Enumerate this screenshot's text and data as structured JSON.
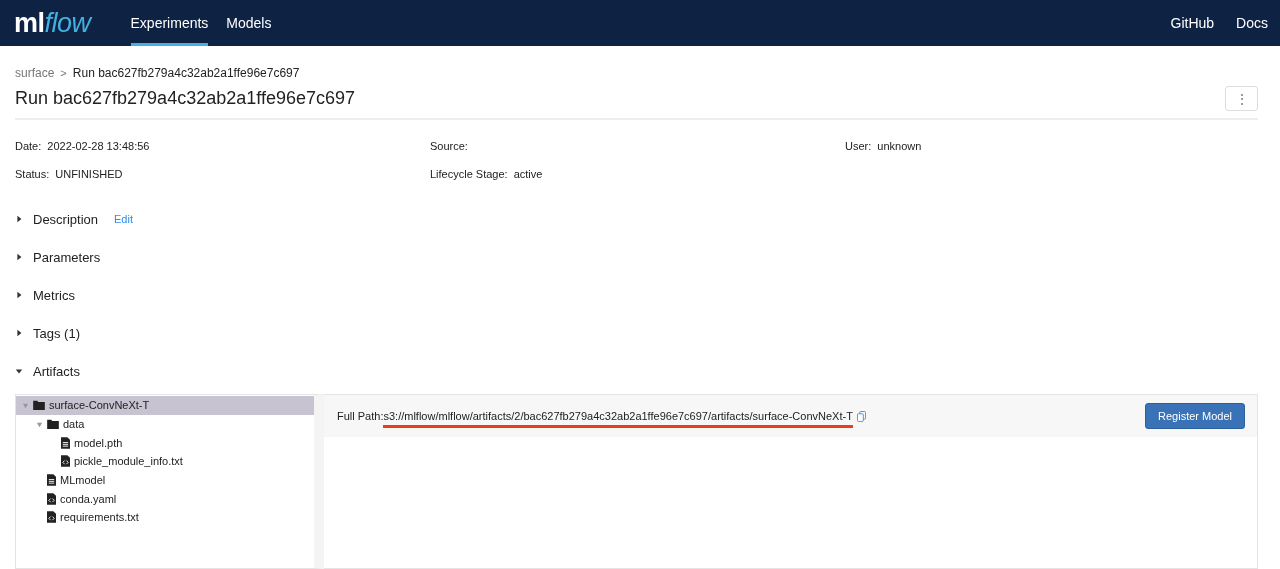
{
  "nav": {
    "logo": {
      "plain": "ml",
      "accent": "flow"
    },
    "tabs": [
      {
        "label": "Experiments",
        "selected": true
      },
      {
        "label": "Models",
        "selected": false
      }
    ],
    "links": [
      "GitHub",
      "Docs"
    ]
  },
  "breadcrumb": {
    "parent": "surface",
    "separator": ">",
    "current": "Run bac627fb279a4c32ab2a1ffe96e7c697"
  },
  "title": "Run bac627fb279a4c32ab2a1ffe96e7c697",
  "menu_button": "⋮",
  "meta": [
    {
      "label": "Date:",
      "value": "2022-02-28 13:48:56"
    },
    {
      "label": "Source:"
    },
    {
      "label": "User:",
      "value": "unknown"
    },
    {
      "label": "Status:",
      "value": "UNFINISHED"
    },
    {
      "label": "Lifecycle Stage:",
      "value": "active"
    }
  ],
  "sections": [
    {
      "label": "Description",
      "expanded": false,
      "action": "Edit"
    },
    {
      "label": "Parameters",
      "expanded": false
    },
    {
      "label": "Metrics",
      "expanded": false
    },
    {
      "label": "Tags (1)",
      "expanded": false
    },
    {
      "label": "Artifacts",
      "expanded": true
    }
  ],
  "artifacts": {
    "tree": [
      {
        "kind": "folder",
        "name": "surface-ConvNeXt-T",
        "expanded": true,
        "selected": true,
        "children": [
          {
            "kind": "folder",
            "name": "data",
            "expanded": true,
            "selected": false,
            "children": [
              {
                "kind": "file",
                "name": "model.pth",
                "selected": false
              },
              {
                "kind": "code",
                "name": "pickle_module_info.txt",
                "selected": false
              }
            ]
          },
          {
            "kind": "file",
            "name": "MLmodel",
            "selected": false
          },
          {
            "kind": "code",
            "name": "conda.yaml",
            "selected": false
          },
          {
            "kind": "code",
            "name": "requirements.txt",
            "selected": false
          }
        ]
      }
    ],
    "path_label": "Full Path:",
    "path": "s3://mlflow/mlflow/artifacts/2/bac627fb279a4c32ab2a1ffe96e7c697/artifacts/surface-ConvNeXt-T",
    "path_underlined": true,
    "register_button": "Register Model"
  }
}
